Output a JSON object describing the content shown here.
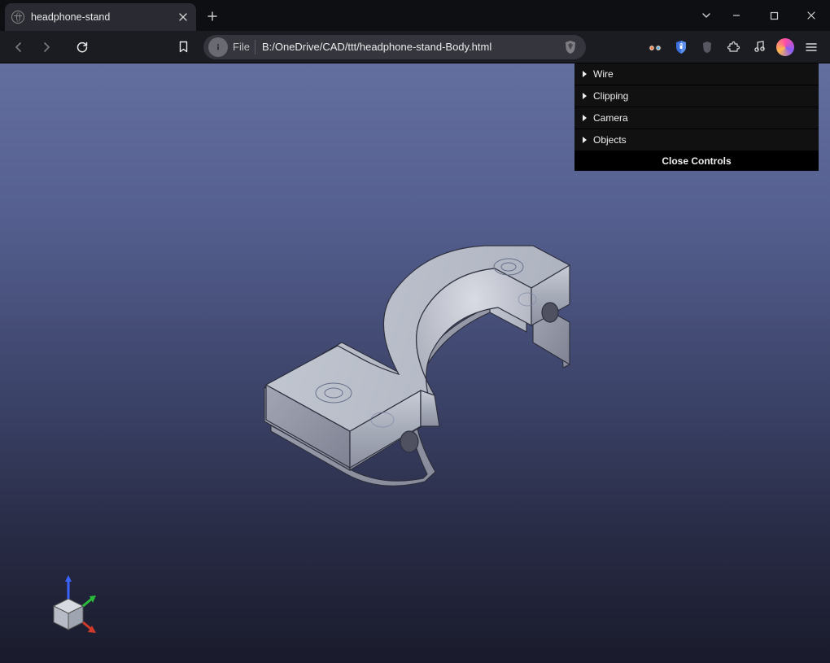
{
  "tab": {
    "title": "headphone-stand"
  },
  "omnibox": {
    "scheme_label": "File",
    "url": "B:/OneDrive/CAD/ttt/headphone-stand-Body.html"
  },
  "controls": {
    "items": [
      "Wire",
      "Clipping",
      "Camera",
      "Objects"
    ],
    "close_label": "Close Controls"
  },
  "icons": {
    "back": "back-icon",
    "forward": "forward-icon",
    "reload": "reload-icon",
    "bookmark": "bookmark-icon",
    "shield": "brave-shield-icon",
    "ext_glasses": "glasses-icon",
    "ext_shield2": "shield-ext-icon",
    "ext_lion": "lion-ext-icon",
    "ext_puzzle": "extensions-icon",
    "ext_music": "music-icon",
    "avatar": "profile-avatar",
    "hamburger": "menu-icon",
    "chevdown": "tabs-chevron-icon",
    "min": "minimize-icon",
    "max": "maximize-icon",
    "close": "window-close-icon",
    "tabclose": "tab-close-icon",
    "newtab": "new-tab-icon",
    "favicon": "globe-favicon",
    "siteinfo": "site-info-icon"
  }
}
